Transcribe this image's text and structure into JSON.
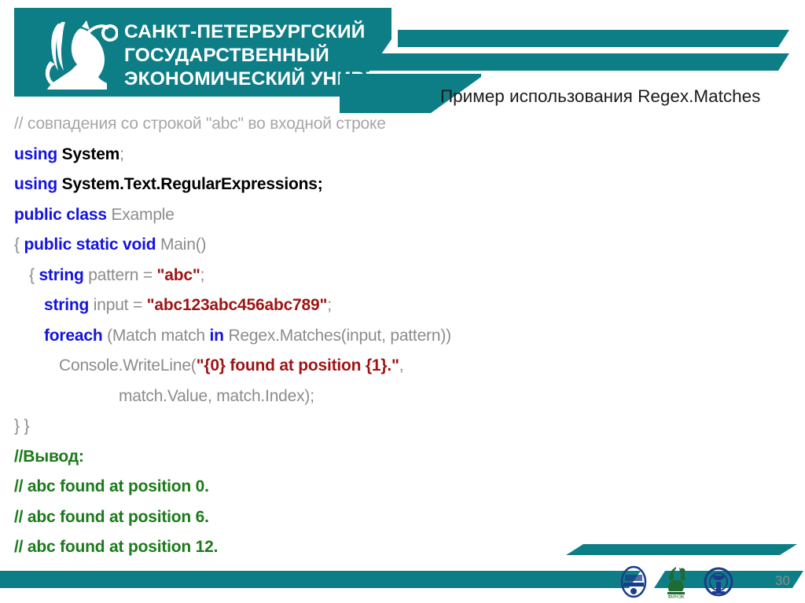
{
  "header": {
    "university_name_lines": [
      "САНКТ-ПЕТЕРБУРГСКИЙ",
      "ГОСУДАРСТВЕННЫЙ",
      "ЭКОНОМИЧЕСКИЙ УНИВЕРСИТЕТ"
    ],
    "logo_icon": "griffin-logo-icon",
    "title": "Пример использования Regex.Matches",
    "brand_color": "#0e7e86"
  },
  "code": {
    "lines": [
      {
        "indent": 0,
        "tokens": [
          {
            "cls": "cmt",
            "t": "// совпадения со строкой \"abc\" во входной строке"
          }
        ]
      },
      {
        "indent": 0,
        "tokens": [
          {
            "cls": "kw",
            "t": "using "
          },
          {
            "cls": "blk",
            "t": "System"
          },
          {
            "cls": "pun",
            "t": ";"
          }
        ]
      },
      {
        "indent": 0,
        "tokens": [
          {
            "cls": "kw",
            "t": "using "
          },
          {
            "cls": "blk",
            "t": "System.Text.RegularExpressions;"
          }
        ]
      },
      {
        "indent": 0,
        "tokens": [
          {
            "cls": "kw",
            "t": "public class "
          },
          {
            "cls": "id",
            "t": "Example"
          }
        ]
      },
      {
        "indent": 0,
        "tokens": [
          {
            "cls": "pun",
            "t": "{ "
          },
          {
            "cls": "kw",
            "t": "public static void "
          },
          {
            "cls": "id",
            "t": "Main()"
          }
        ]
      },
      {
        "indent": 1,
        "tokens": [
          {
            "cls": "pun",
            "t": "{ "
          },
          {
            "cls": "kw",
            "t": "string "
          },
          {
            "cls": "id",
            "t": "pattern = "
          },
          {
            "cls": "str",
            "t": "\"abc\""
          },
          {
            "cls": "pun",
            "t": ";"
          }
        ]
      },
      {
        "indent": 2,
        "tokens": [
          {
            "cls": "kw",
            "t": "string "
          },
          {
            "cls": "id",
            "t": "input = "
          },
          {
            "cls": "str",
            "t": "\"abc123abc456abc789\""
          },
          {
            "cls": "pun",
            "t": ";"
          }
        ]
      },
      {
        "indent": 2,
        "tokens": [
          {
            "cls": "kw",
            "t": "foreach "
          },
          {
            "cls": "id",
            "t": "(Match match "
          },
          {
            "cls": "kw",
            "t": "in "
          },
          {
            "cls": "id",
            "t": "Regex.Matches(input, pattern))"
          }
        ]
      },
      {
        "indent": 3,
        "tokens": [
          {
            "cls": "id",
            "t": "Console.WriteLine("
          },
          {
            "cls": "str",
            "t": "\"{0} found at position {1}.\""
          },
          {
            "cls": "id",
            "t": ","
          }
        ]
      },
      {
        "indent": 7,
        "tokens": [
          {
            "cls": "id",
            "t": "match.Value, match.Index);"
          }
        ]
      },
      {
        "indent": 0,
        "tokens": [
          {
            "cls": "pun",
            "t": "} }"
          }
        ]
      },
      {
        "indent": 0,
        "tokens": [
          {
            "cls": "out",
            "t": "//Вывод:"
          }
        ]
      },
      {
        "indent": 0,
        "tokens": [
          {
            "cls": "out",
            "t": "// abc found at position 0."
          }
        ]
      },
      {
        "indent": 0,
        "tokens": [
          {
            "cls": "out",
            "t": "// abc found at position 6."
          }
        ]
      },
      {
        "indent": 0,
        "tokens": [
          {
            "cls": "out",
            "t": "// abc found at position 12."
          }
        ]
      }
    ],
    "colors": {
      "keyword": "#1414dc",
      "identifier": "#8c8c8c",
      "string": "#9e1414",
      "comment": "#a6a6a6",
      "output_comment": "#1b7a1b",
      "plain": "#000000"
    }
  },
  "footer": {
    "page_number": "30",
    "logos": [
      {
        "name": "inzhekon-logo-icon",
        "label": "ИНЖЭКОН"
      },
      {
        "name": "finek-logo-icon",
        "label": "ФИНЭК"
      },
      {
        "name": "spbguef-logo-icon",
        "label": "СПбГУЭФ"
      }
    ]
  }
}
